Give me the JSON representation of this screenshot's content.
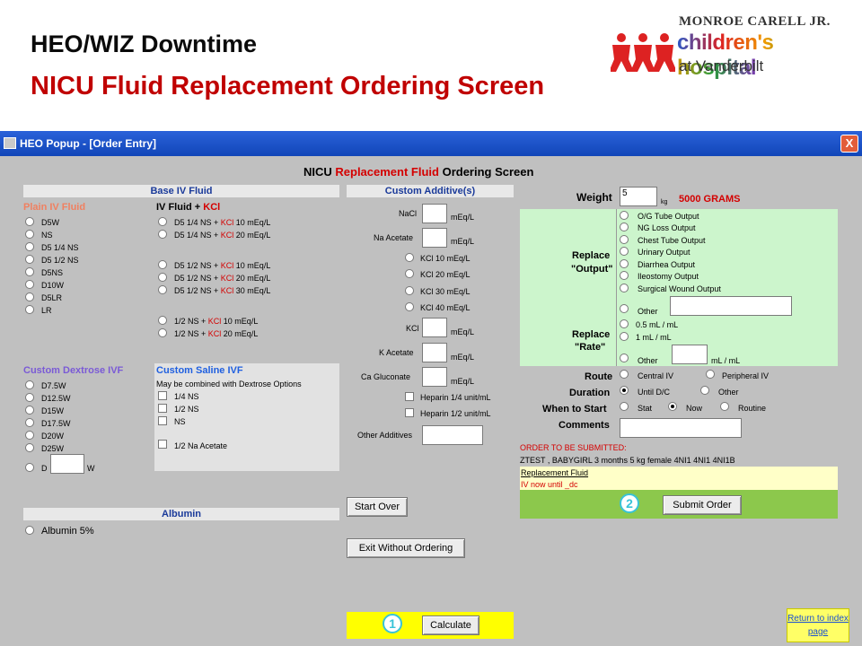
{
  "slide": {
    "title_line1": "HEO/WIZ Downtime",
    "title_line2": "NICU Fluid Replacement Ordering Screen",
    "logo": {
      "line1": "MONROE CARELL JR.",
      "line2": "children's hospital",
      "line3": "at Vanderbilt"
    },
    "return_link": "Return to index page"
  },
  "window": {
    "title": "HEO Popup - [Order Entry]",
    "close_label": "X"
  },
  "screen": {
    "title_pre": "NICU ",
    "title_red": "Replacement Fluid",
    "title_post": " Ordering Screen"
  },
  "base_iv": {
    "header": "Base IV Fluid",
    "plain_header": "Plain IV Fluid",
    "plain_items": [
      "D5W",
      "NS",
      "D5 1/4 NS",
      "D5 1/2 NS",
      "D5NS",
      "D10W",
      "D5LR",
      "LR"
    ],
    "kcl_header_pre": "IV Fluid + ",
    "kcl_header_red": "KCl",
    "kcl_items": [
      {
        "pre": "D5 1/4 NS + ",
        "red": "KCl",
        "post": " 10 mEq/L"
      },
      {
        "pre": "D5 1/4 NS + ",
        "red": "KCl",
        "post": " 20 mEq/L"
      },
      {
        "pre": "D5 1/2 NS + ",
        "red": "KCl",
        "post": " 10 mEq/L"
      },
      {
        "pre": "D5 1/2 NS + ",
        "red": "KCl",
        "post": " 20 mEq/L"
      },
      {
        "pre": "D5 1/2 NS + ",
        "red": "KCl",
        "post": " 30 mEq/L"
      },
      {
        "pre": "1/2 NS + ",
        "red": "KCl",
        "post": " 10 mEq/L"
      },
      {
        "pre": "1/2 NS + ",
        "red": "KCl",
        "post": " 20 mEq/L"
      }
    ]
  },
  "dextrose": {
    "header": "Custom Dextrose IVF",
    "items": [
      "D7.5W",
      "D12.5W",
      "D15W",
      "D17.5W",
      "D20W",
      "D25W"
    ],
    "custom_prefix": "D",
    "custom_suffix": "W",
    "custom_value": ""
  },
  "saline": {
    "header": "Custom Saline IVF",
    "note": "May be combined with Dextrose Options",
    "items": [
      "1/4 NS",
      "1/2 NS",
      "NS"
    ],
    "extra": "1/2 Na Acetate"
  },
  "albumin": {
    "header": "Albumin",
    "item": "Albumin 5%"
  },
  "additives": {
    "header": "Custom Additive(s)",
    "nacl_label": "NaCl",
    "nacl_unit": "mEq/L",
    "naacetate_label": "Na Acetate",
    "naacetate_unit": "mEq/L",
    "kcl_options": [
      "KCl 10 mEq/L",
      "KCl 20 mEq/L",
      "KCl 30 mEq/L",
      "KCl 40 mEq/L"
    ],
    "kcl_label": "KCl",
    "kcl_unit": "mEq/L",
    "kacetate_label": "K Acetate",
    "kacetate_unit": "mEq/L",
    "cagluc_label": "Ca Gluconate",
    "cagluc_unit": "mEq/L",
    "heparin1": "Heparin 1/4 unit/mL",
    "heparin2": "Heparin 1/2 unit/mL",
    "other_label": "Other Additives"
  },
  "order": {
    "weight_label": "Weight",
    "weight_value": "5",
    "weight_unit": "kg",
    "weight_grams": "5000 GRAMS",
    "replace_output_label1": "Replace",
    "replace_output_label2": "\"Output\"",
    "output_options": [
      "O/G Tube Output",
      "NG Loss Output",
      "Chest Tube Output",
      "Urinary Output",
      "Diarrhea Output",
      "Ileostomy Output",
      "Surgical Wound Output"
    ],
    "output_other": "Other",
    "replace_rate_label1": "Replace",
    "replace_rate_label2": "\"Rate\"",
    "rate_options": [
      "0.5 mL / mL",
      "1 mL / mL"
    ],
    "rate_other": "Other",
    "rate_other_unit": "mL / mL",
    "route_label": "Route",
    "route_options": [
      "Central IV",
      "Peripheral IV"
    ],
    "duration_label": "Duration",
    "duration_options": [
      "Until D/C",
      "Other"
    ],
    "start_label": "When to Start",
    "start_options": [
      "Stat",
      "Now",
      "Routine"
    ],
    "comments_label": "Comments",
    "submitted_label": "ORDER TO BE SUBMITTED:",
    "patient_line": "ZTEST , BABYGIRL   3 months 5 kg female     4NI1 4NI1 4NI1B",
    "summary1": "Replacement Fluid",
    "summary2": "IV now until _dc"
  },
  "buttons": {
    "start_over": "Start Over",
    "exit": "Exit Without Ordering",
    "calculate": "Calculate",
    "submit": "Submit Order",
    "badge1": "1",
    "badge2": "2"
  },
  "colors": {
    "accent_red": "#d40000",
    "panel_green": "#ccf5cc",
    "highlight_yellow": "#ffff00",
    "title_bar_blue": "#1146b8"
  }
}
